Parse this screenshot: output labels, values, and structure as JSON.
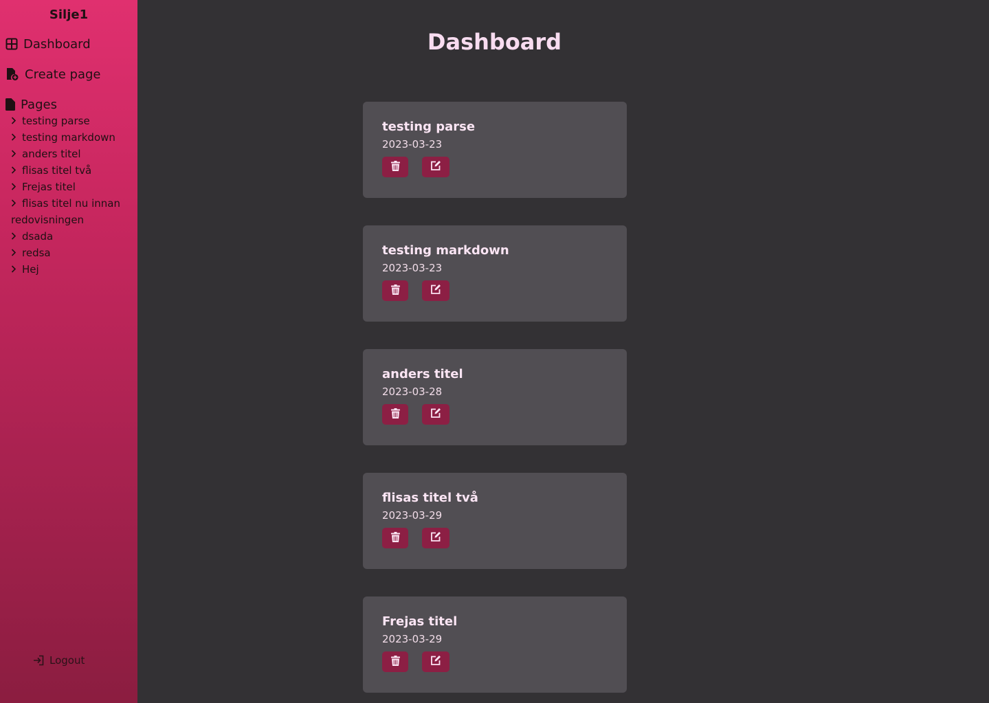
{
  "sidebar": {
    "brand": "Silje1",
    "dashboard_label": "Dashboard",
    "create_label": "Create page",
    "pages_label": "Pages",
    "pages": [
      "testing parse",
      "testing markdown",
      "anders titel",
      "flisas titel två",
      "Frejas titel",
      "flisas titel nu innan redovisningen",
      "dsada",
      "redsa",
      "Hej"
    ],
    "logout_label": "Logout"
  },
  "main": {
    "title": "Dashboard",
    "cards": [
      {
        "title": "testing parse",
        "date": "2023-03-23"
      },
      {
        "title": "testing markdown",
        "date": "2023-03-23"
      },
      {
        "title": "anders titel",
        "date": "2023-03-28"
      },
      {
        "title": "flisas titel två",
        "date": "2023-03-29"
      },
      {
        "title": "Frejas titel",
        "date": "2023-03-29"
      }
    ]
  },
  "colors": {
    "background": "#333134",
    "card": "#514e53",
    "button": "#8c1f44",
    "sidebar_top": "#e0306f",
    "sidebar_bottom": "#8b1d40",
    "title": "#f8dcf0"
  }
}
